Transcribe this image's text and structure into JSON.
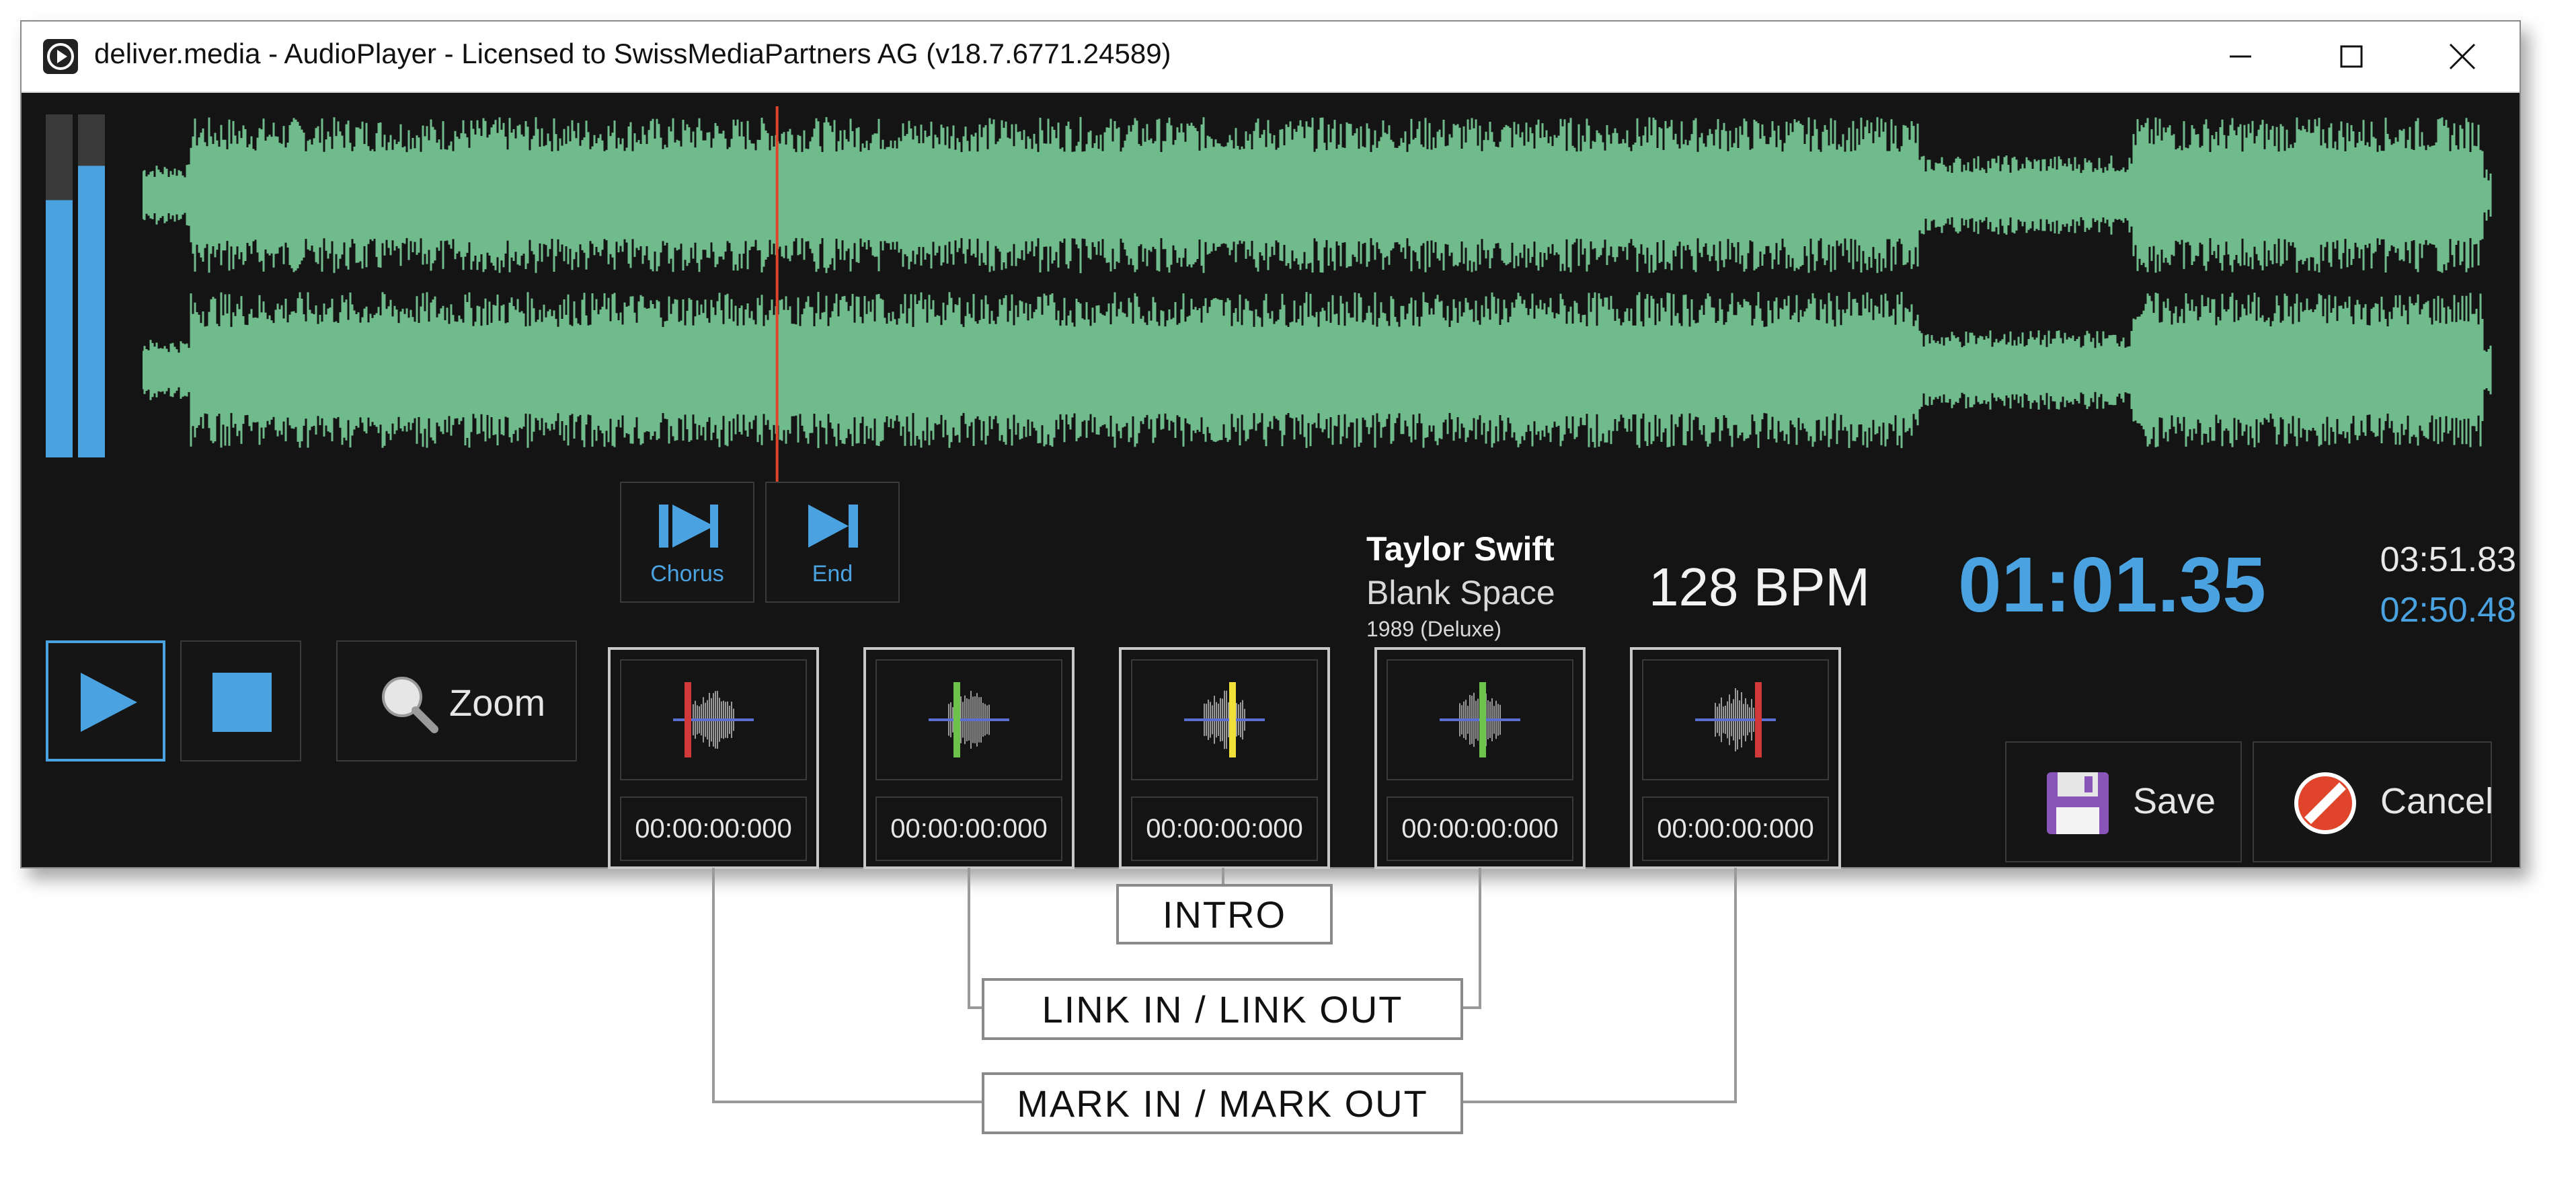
{
  "window": {
    "title": "deliver.media - AudioPlayer - Licensed to SwissMediaPartners AG (v18.7.6771.24589)",
    "controls": [
      "minimize",
      "maximize",
      "close"
    ]
  },
  "waveform": {
    "color": "#6fbb8c",
    "playhead_color": "#e0452b",
    "channels": 2,
    "playhead_position": 0.27
  },
  "level_meter": {
    "left_level": 0.75,
    "right_level": 0.85,
    "color": "#4aa3e0"
  },
  "cue_buttons": [
    {
      "label": "Chorus",
      "icon": "skip-to-chorus-icon"
    },
    {
      "label": "End",
      "icon": "skip-to-end-icon"
    }
  ],
  "transport": {
    "play_icon": "play-icon",
    "stop_icon": "stop-icon",
    "zoom_label": "Zoom",
    "zoom_icon": "magnifier-icon"
  },
  "markers": [
    {
      "name": "mark-in",
      "time": "00:00:00:000",
      "marker_color": "#d23a3a"
    },
    {
      "name": "link-in",
      "time": "00:00:00:000",
      "marker_color": "#6cc24a"
    },
    {
      "name": "intro",
      "time": "00:00:00:000",
      "marker_color": "#f2e03a"
    },
    {
      "name": "link-out",
      "time": "00:00:00:000",
      "marker_color": "#6cc24a"
    },
    {
      "name": "mark-out",
      "time": "00:00:00:000",
      "marker_color": "#d23a3a"
    }
  ],
  "track": {
    "artist": "Taylor Swift",
    "title": "Blank Space",
    "album": "1989 (Deluxe)",
    "bpm": "128 BPM"
  },
  "time": {
    "position": "01:01.35",
    "total": "03:51.83",
    "remaining": "02:50.48"
  },
  "actions": {
    "save_label": "Save",
    "cancel_label": "Cancel"
  },
  "annotations": {
    "intro": "INTRO",
    "link": "LINK IN / LINK OUT",
    "mark": "MARK IN / MARK OUT"
  }
}
